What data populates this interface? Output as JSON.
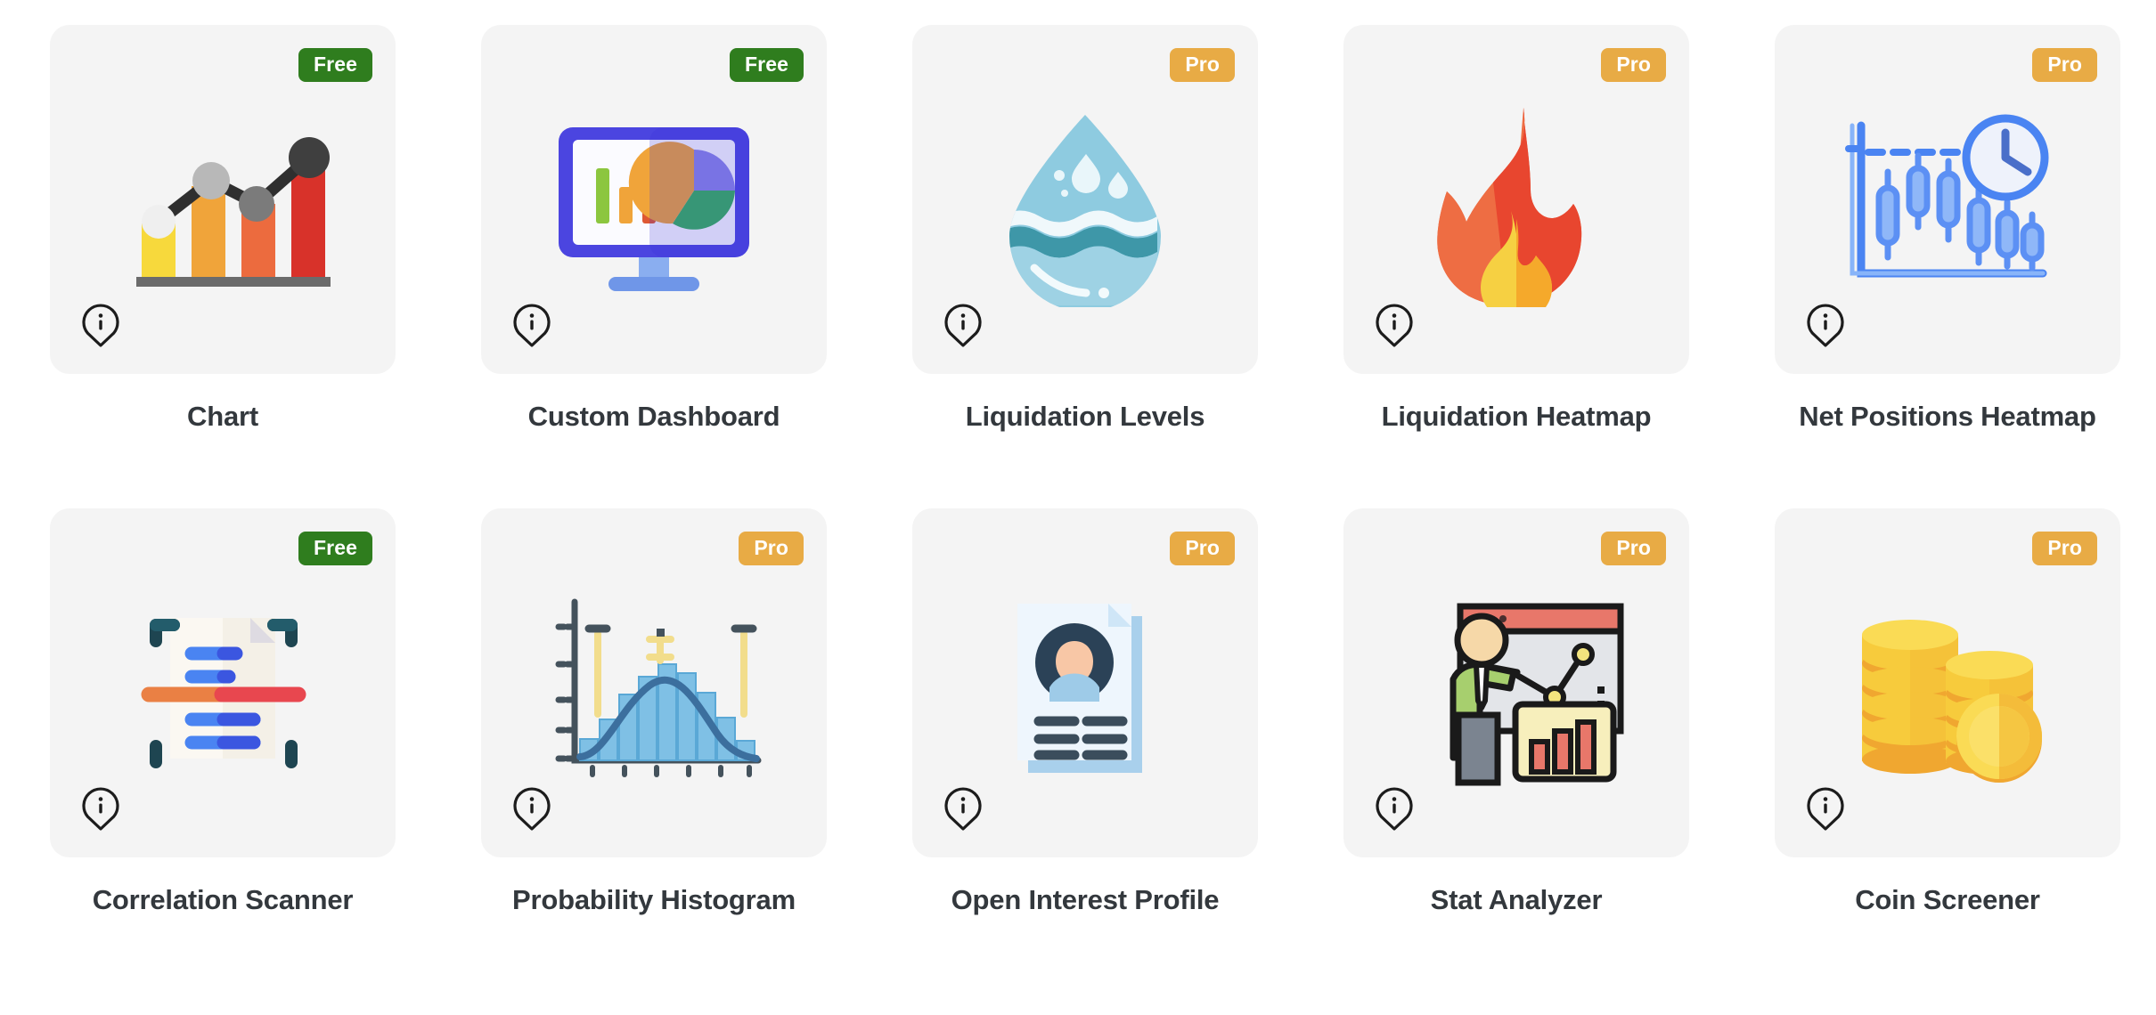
{
  "page": {
    "background": "#ffffff",
    "card_background": "#f4f4f4",
    "title_color": "#33383d",
    "badge_colors": {
      "free": "#2f7d1e",
      "pro": "#e8ab45"
    },
    "columns": 5
  },
  "badges": {
    "free_label": "Free",
    "pro_label": "Pro"
  },
  "info_icon_name": "info-pin-icon",
  "tools": [
    {
      "title": "Chart",
      "badge": "Free",
      "badge_type": "free",
      "icon": "bar-chart-line-icon",
      "info": "info-pin-icon"
    },
    {
      "title": "Custom Dashboard",
      "badge": "Free",
      "badge_type": "free",
      "icon": "monitor-dashboard-icon",
      "info": "info-pin-icon"
    },
    {
      "title": "Liquidation Levels",
      "badge": "Pro",
      "badge_type": "pro",
      "icon": "water-droplet-icon",
      "info": "info-pin-icon"
    },
    {
      "title": "Liquidation Heatmap",
      "badge": "Pro",
      "badge_type": "pro",
      "icon": "flame-icon",
      "info": "info-pin-icon"
    },
    {
      "title": "Net Positions Heatmap",
      "badge": "Pro",
      "badge_type": "pro",
      "icon": "candlestick-clock-icon",
      "info": "info-pin-icon"
    },
    {
      "title": "Correlation Scanner",
      "badge": "Free",
      "badge_type": "free",
      "icon": "document-scan-icon",
      "info": "info-pin-icon"
    },
    {
      "title": "Probability Histogram",
      "badge": "Pro",
      "badge_type": "pro",
      "icon": "bell-curve-histogram-icon",
      "info": "info-pin-icon"
    },
    {
      "title": "Open Interest Profile",
      "badge": "Pro",
      "badge_type": "pro",
      "icon": "profile-document-icon",
      "info": "info-pin-icon"
    },
    {
      "title": "Stat Analyzer",
      "badge": "Pro",
      "badge_type": "pro",
      "icon": "presenter-chart-icon",
      "info": "info-pin-icon"
    },
    {
      "title": "Coin Screener",
      "badge": "Pro",
      "badge_type": "pro",
      "icon": "gold-coins-icon",
      "info": "info-pin-icon"
    }
  ]
}
